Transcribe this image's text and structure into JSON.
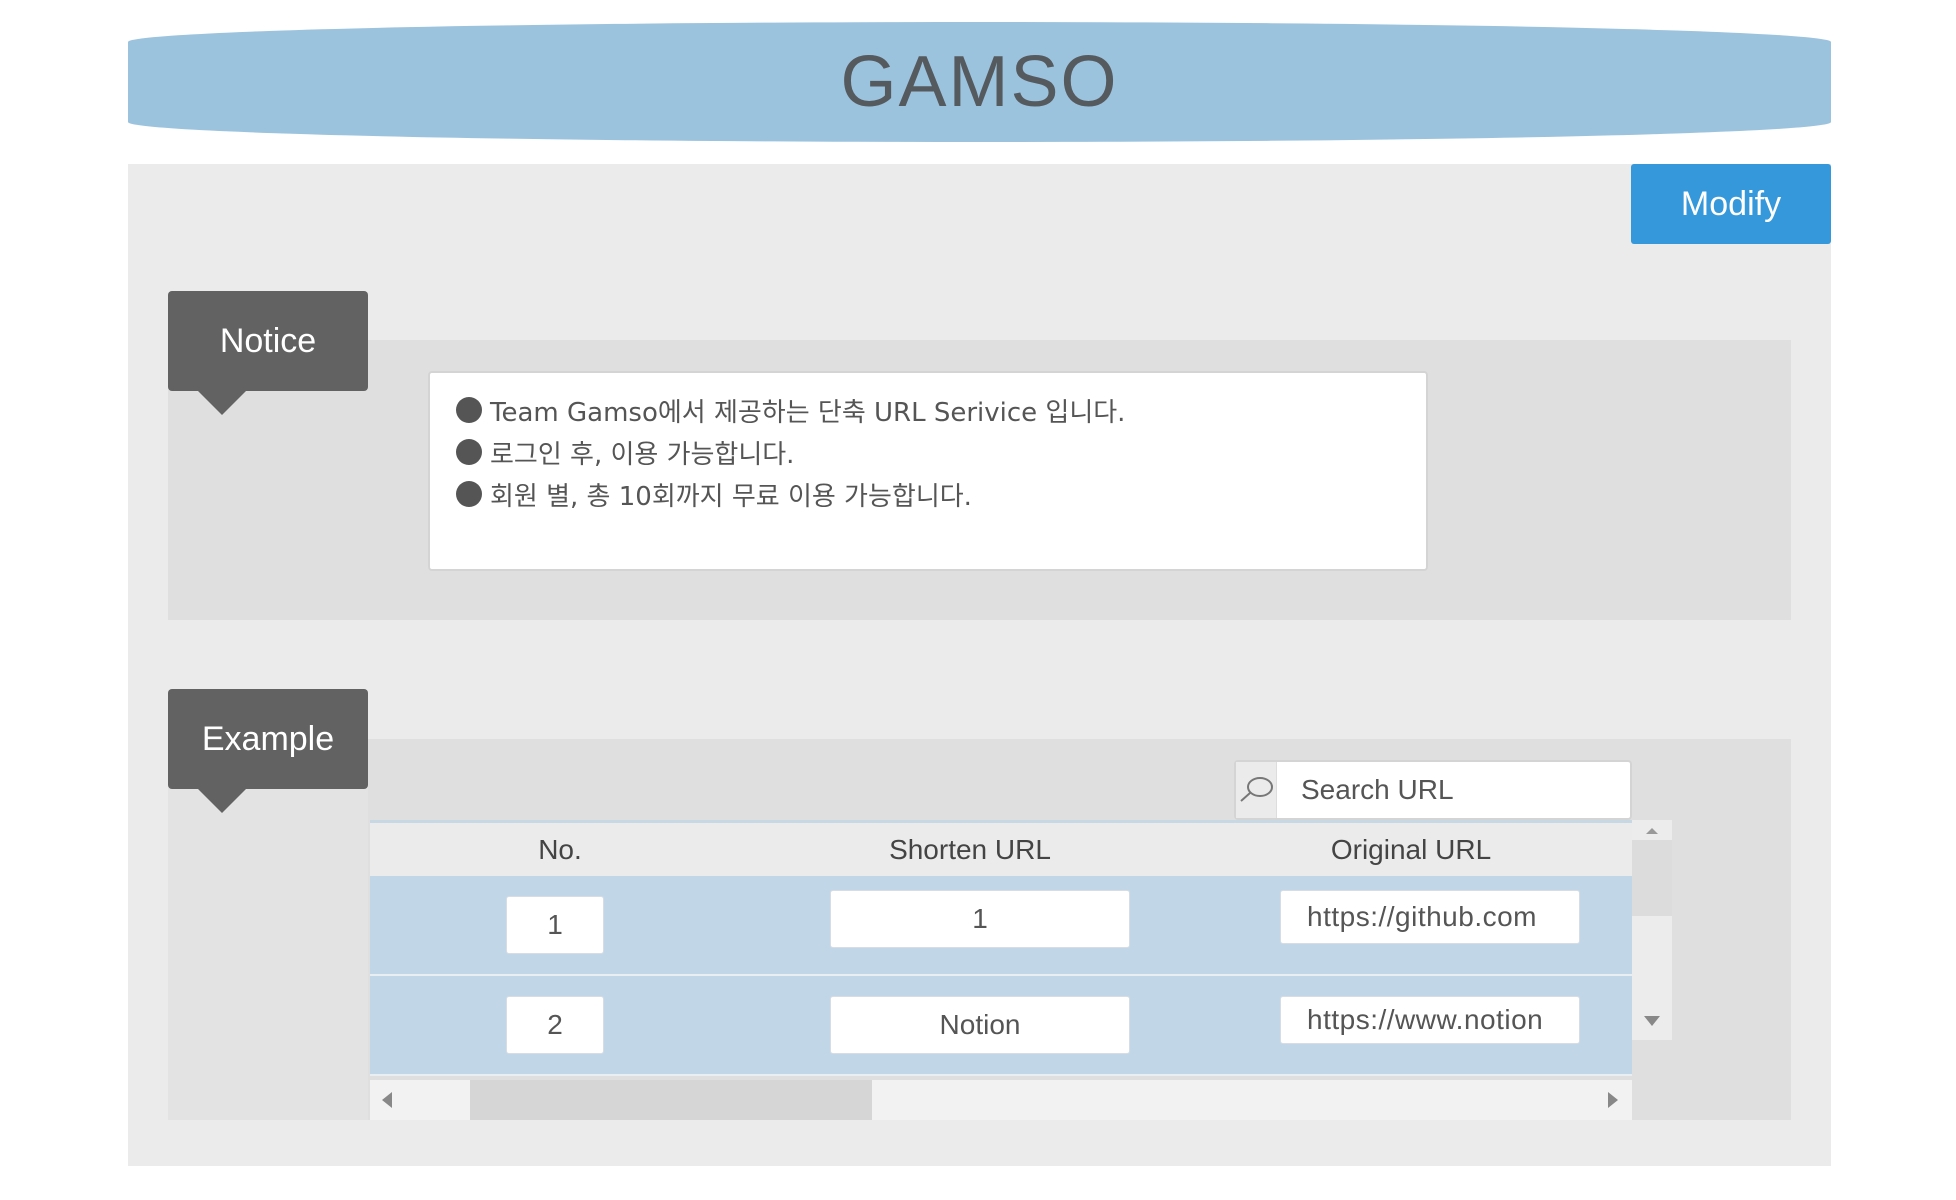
{
  "header": {
    "title": "GAMSO"
  },
  "toolbar": {
    "modify_label": "Modify"
  },
  "notice": {
    "tag_label": "Notice",
    "lines": [
      "Team Gamso에서 제공하는 단축 URL Serivice 입니다.",
      "로그인 후, 이용 가능합니다.",
      "회원 별, 총 10회까지 무료 이용 가능합니다."
    ]
  },
  "example": {
    "tag_label": "Example",
    "search": {
      "placeholder": "Search URL",
      "icon": "search-icon"
    },
    "table": {
      "columns": [
        "No.",
        "Shorten URL",
        "Original URL"
      ],
      "rows": [
        {
          "no": "1",
          "shorten": "1",
          "original": "https://github.com"
        },
        {
          "no": "2",
          "shorten": "Notion",
          "original": "https://www.notion"
        }
      ]
    }
  },
  "colors": {
    "header_bg": "#9cc3de",
    "accent_button": "#3498db",
    "tag_bg": "#626262",
    "row_bg": "#c1d7e7"
  }
}
